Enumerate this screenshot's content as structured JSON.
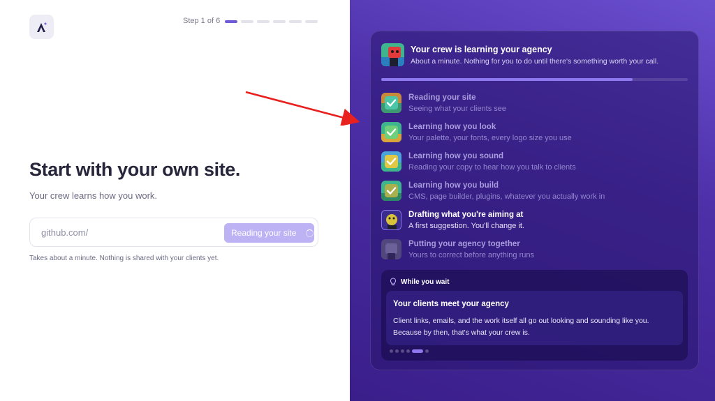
{
  "left": {
    "step_text": "Step 1 of 6",
    "steps_total": 6,
    "steps_current": 1,
    "headline": "Start with your own site.",
    "subhead": "Your crew learns how you work.",
    "url_placeholder": "github.com/",
    "read_button": "Reading your site",
    "note": "Takes about a minute. Nothing is shared with your clients yet."
  },
  "card": {
    "title": "Your crew is learning your agency",
    "subtitle": "About a minute. Nothing for you to do until there's something worth your call.",
    "progress": 0.82,
    "tasks": [
      {
        "name": "Reading your site",
        "desc": "Seeing what your clients see",
        "state": "done"
      },
      {
        "name": "Learning how you look",
        "desc": "Your palette, your fonts, every logo size you use",
        "state": "done"
      },
      {
        "name": "Learning how you sound",
        "desc": "Reading your copy to hear how you talk to clients",
        "state": "done"
      },
      {
        "name": "Learning how you build",
        "desc": "CMS, page builder, plugins, whatever you actually work in",
        "state": "done"
      },
      {
        "name": "Drafting what you're aiming at",
        "desc": "A first suggestion. You'll change it.",
        "state": "active"
      },
      {
        "name": "Putting your agency together",
        "desc": "Yours to correct before anything runs",
        "state": "pending"
      }
    ],
    "wait": {
      "label": "While you wait",
      "title": "Your clients meet your agency",
      "body": "Client links, emails, and the work itself all go out looking and sounding like you. Because by then, that's what your crew is.",
      "slides_total": 6,
      "slide_active": 5
    }
  },
  "colors": {
    "accent": "#6f5ad8",
    "button_disabled": "#bdb2f4",
    "panel_bg": "#4d2fa8",
    "arrow": "#e8201e"
  }
}
